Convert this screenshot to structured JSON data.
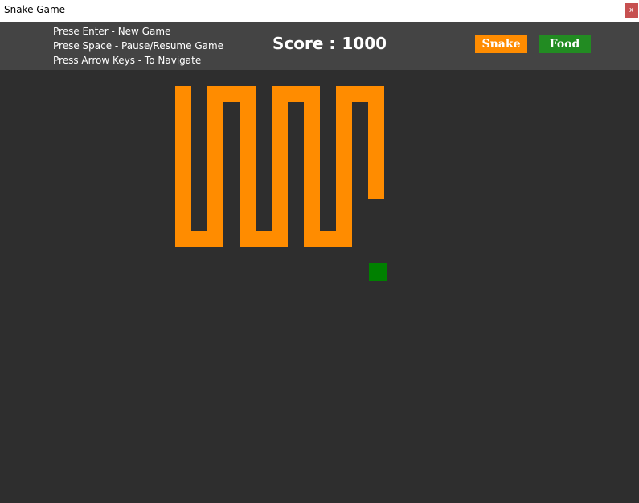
{
  "window": {
    "title": "Snake Game",
    "close_label": "x"
  },
  "instructions": [
    "Prese Enter - New Game",
    "Prese Space - Pause/Resume Game",
    "Press Arrow Keys - To Navigate"
  ],
  "score": {
    "label": "Score :",
    "value": "1000"
  },
  "legend": {
    "snake_label": "Snake",
    "food_label": "Food"
  },
  "colors": {
    "snake": "#ff8c00",
    "food": "#008000",
    "food_legend": "#228b22",
    "board": "#2e2e2e",
    "header": "#444444"
  },
  "game": {
    "grid_cols": 40,
    "grid_rows": 27,
    "snake_cells": [
      [
        11,
        1
      ],
      [
        11,
        2
      ],
      [
        11,
        3
      ],
      [
        11,
        4
      ],
      [
        11,
        5
      ],
      [
        11,
        6
      ],
      [
        11,
        7
      ],
      [
        11,
        8
      ],
      [
        11,
        9
      ],
      [
        11,
        10
      ],
      [
        12,
        10
      ],
      [
        13,
        10
      ],
      [
        13,
        9
      ],
      [
        13,
        8
      ],
      [
        13,
        7
      ],
      [
        13,
        6
      ],
      [
        13,
        5
      ],
      [
        13,
        4
      ],
      [
        13,
        3
      ],
      [
        13,
        2
      ],
      [
        13,
        1
      ],
      [
        14,
        1
      ],
      [
        15,
        1
      ],
      [
        15,
        2
      ],
      [
        15,
        3
      ],
      [
        15,
        4
      ],
      [
        15,
        5
      ],
      [
        15,
        6
      ],
      [
        15,
        7
      ],
      [
        15,
        8
      ],
      [
        15,
        9
      ],
      [
        15,
        10
      ],
      [
        16,
        10
      ],
      [
        17,
        10
      ],
      [
        17,
        9
      ],
      [
        17,
        8
      ],
      [
        17,
        7
      ],
      [
        17,
        6
      ],
      [
        17,
        5
      ],
      [
        17,
        4
      ],
      [
        17,
        3
      ],
      [
        17,
        2
      ],
      [
        17,
        1
      ],
      [
        18,
        1
      ],
      [
        19,
        1
      ],
      [
        19,
        2
      ],
      [
        19,
        3
      ],
      [
        19,
        4
      ],
      [
        19,
        5
      ],
      [
        19,
        6
      ],
      [
        19,
        7
      ],
      [
        19,
        8
      ],
      [
        19,
        9
      ],
      [
        19,
        10
      ],
      [
        20,
        10
      ],
      [
        21,
        10
      ],
      [
        21,
        9
      ],
      [
        21,
        8
      ],
      [
        21,
        7
      ],
      [
        21,
        6
      ],
      [
        21,
        5
      ],
      [
        21,
        4
      ],
      [
        21,
        3
      ],
      [
        21,
        2
      ],
      [
        21,
        1
      ],
      [
        22,
        1
      ],
      [
        23,
        1
      ],
      [
        23,
        2
      ],
      [
        23,
        3
      ],
      [
        23,
        4
      ],
      [
        23,
        5
      ],
      [
        23,
        6
      ],
      [
        23,
        7
      ]
    ],
    "food_cell": [
      23,
      12
    ]
  }
}
